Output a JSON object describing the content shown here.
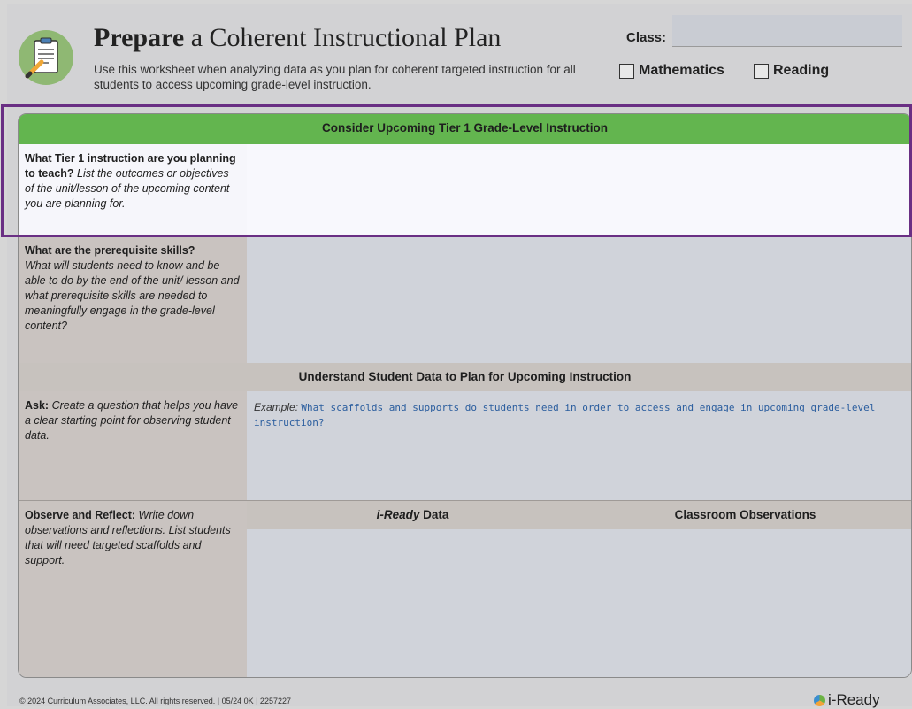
{
  "header": {
    "title_bold": "Prepare",
    "title_rest": " a Coherent Instructional Plan",
    "subtitle": "Use this worksheet when analyzing data as you plan for coherent targeted instruction for all students to access upcoming grade-level instruction.",
    "class_label": "Class:",
    "class_value": "",
    "checkbox_math": "Mathematics",
    "checkbox_reading": "Reading"
  },
  "sections": {
    "tier1_header": "Consider Upcoming Tier 1 Grade-Level Instruction",
    "student_data_header": "Understand Student Data to Plan for Upcoming Instruction"
  },
  "rows": {
    "tier1_q_bold": "What Tier 1 instruction are you planning to teach?",
    "tier1_q_italic": " List the outcomes or objectives of the unit/lesson of the upcoming content you are planning for.",
    "prereq_q_bold": "What are the prerequisite skills?",
    "prereq_q_italic": "What will students need to know and be able to do by the end of the unit/ lesson and what prerequisite skills are needed to meaningfully engage in the grade-level content?",
    "ask_bold": "Ask:",
    "ask_italic": " Create a question that helps you have a clear starting point for observing student data.",
    "ask_example_label": "Example:",
    "ask_example_text": "What scaffolds and supports do students need in order to access and engage in upcoming grade-level instruction?",
    "observe_bold": "Observe and Reflect:",
    "observe_italic": " Write down observations and reflections. List students that will need targeted scaffolds and support.",
    "col_iready_italic": "i-Ready",
    "col_iready_rest": " Data",
    "col_classroom": "Classroom Observations"
  },
  "footer": {
    "copyright": "© 2024 Curriculum Associates, LLC. All rights reserved. | 05/24 0K | 2257227",
    "logo": "i-Ready"
  },
  "colors": {
    "green_band": "#63b54f",
    "highlight": "#6a2f84",
    "example_text": "#2a5d9e"
  }
}
